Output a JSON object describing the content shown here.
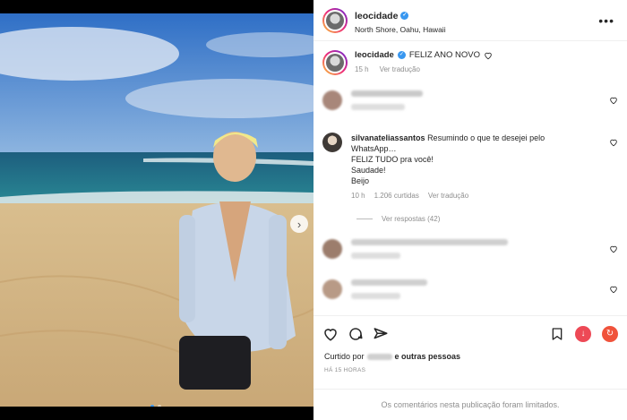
{
  "header": {
    "username": "leocidade",
    "location": "North Shore, Oahu, Hawaii",
    "more_label": "•••"
  },
  "caption": {
    "username": "leocidade",
    "text": "FELIZ ANO NOVO",
    "time": "15 h",
    "translate": "Ver tradução"
  },
  "comments": {
    "c1": {
      "hidden": true
    },
    "c2": {
      "username": "silvanateliassantos",
      "lines": [
        "Resumindo o que te desejei pelo",
        "WhatsApp…",
        "FELIZ TUDO pra você!",
        "Saudade!",
        "Beijo"
      ],
      "time": "10 h",
      "likes": "1.206 curtidas",
      "translate": "Ver tradução",
      "replies": "Ver respostas (42)"
    },
    "c3": {
      "hidden": true
    },
    "c4": {
      "hidden": true
    }
  },
  "actions": {
    "liked_by_prefix": "Curtido por",
    "liked_by_suffix": "e outras pessoas",
    "timestamp": "HÁ 15 HORAS"
  },
  "footer": {
    "limited_text": "Os comentários nesta publicação foram limitados."
  },
  "colors": {
    "accent": "#3897f0",
    "text": "#262626",
    "muted": "#8e8e8e",
    "download": "#ed4956"
  },
  "carousel": {
    "current": 1,
    "total": 2
  }
}
